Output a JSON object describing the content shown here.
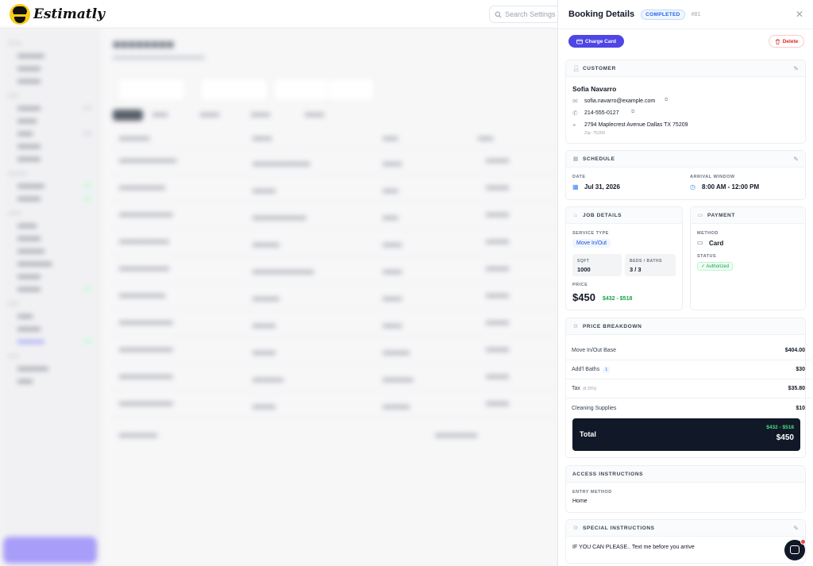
{
  "app": {
    "name": "Estimatly"
  },
  "search": {
    "placeholder": "Search Settings"
  },
  "panel": {
    "title": "Booking Details",
    "status": "COMPLETED",
    "booking_id": "#81",
    "charge_label": "Charge Card",
    "delete_label": "Delete"
  },
  "customer": {
    "heading": "CUSTOMER",
    "name": "Sofia Navarro",
    "email": "sofia.navarro@example.com",
    "phone": "214-555-0127",
    "address": "2794 Maplecrest Avenue Dallas TX 75209",
    "zip": "Zip: 75209"
  },
  "schedule": {
    "heading": "SCHEDULE",
    "date_label": "DATE",
    "date": "Jul 31, 2026",
    "window_label": "ARRIVAL WINDOW",
    "window": "8:00 AM - 12:00 PM"
  },
  "job": {
    "heading": "JOB DETAILS",
    "service_type_label": "SERVICE TYPE",
    "service_type": "Move In/Out",
    "sqft_label": "SQFT",
    "sqft": "1000",
    "beds_baths_label": "BEDS / BATHS",
    "beds_baths": "3 / 3",
    "price_label": "PRICE",
    "price": "$450",
    "price_range": "$432 - $518"
  },
  "payment": {
    "heading": "PAYMENT",
    "method_label": "METHOD",
    "method": "Card",
    "status_label": "STATUS",
    "status": "Authorized"
  },
  "breakdown": {
    "heading": "PRICE BREAKDOWN",
    "rows": [
      {
        "label": "Move In/Out Base",
        "value": "$404.00"
      },
      {
        "label": "Add'l Baths",
        "badge": "1",
        "value": "$30"
      },
      {
        "label": "Tax",
        "note": "(8.25%)",
        "value": "$35.80"
      },
      {
        "label": "Cleaning Supplies",
        "value": "$10"
      }
    ],
    "total_label": "Total",
    "total_range": "$432 - $518",
    "total": "$450"
  },
  "access": {
    "heading": "ACCESS INSTRUCTIONS",
    "entry_label": "ENTRY METHOD",
    "entry": "Home"
  },
  "special": {
    "heading": "SPECIAL INSTRUCTIONS",
    "text": "IF YOU CAN PLEASE.. Text me before you arrive"
  },
  "colors": {
    "accent": "#4f46e5",
    "success": "#16a34a",
    "danger": "#dc2626",
    "dark": "#111827"
  }
}
